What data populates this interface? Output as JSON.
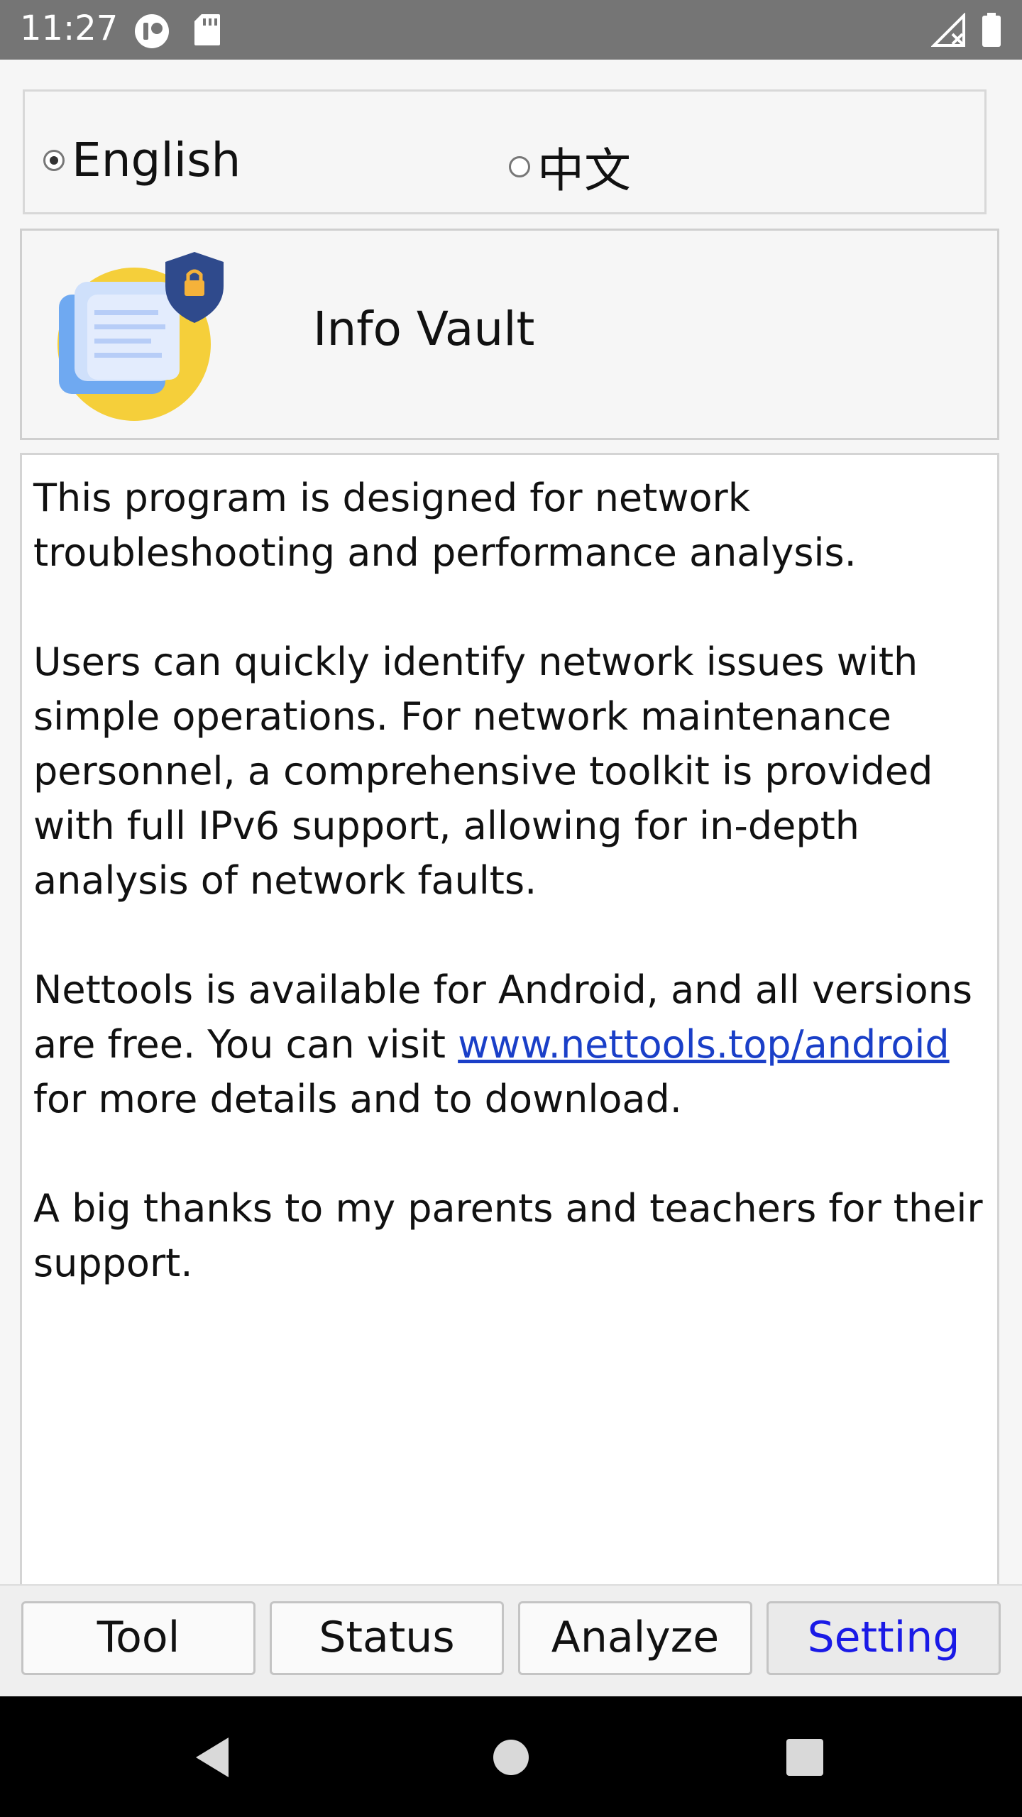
{
  "status_bar": {
    "time": "11:27"
  },
  "language": {
    "options": [
      {
        "label": "English",
        "checked": true
      },
      {
        "label": "中文",
        "checked": false
      }
    ]
  },
  "header": {
    "title": "Info Vault"
  },
  "content": {
    "paragraph1": "This program is designed for network troubleshooting and performance analysis.",
    "paragraph2": "Users can quickly identify network issues with simple operations. For network maintenance personnel, a comprehensive toolkit is provided with full IPv6 support, allowing for in-depth analysis of network faults.",
    "paragraph3_before": "Nettools is available for Android, and all versions are free. You can visit ",
    "paragraph3_link": "www.nettools.top/android",
    "paragraph3_after": " for more details and to download.",
    "paragraph4": "A big thanks to my parents and teachers for their support."
  },
  "tabs": [
    {
      "label": "Tool"
    },
    {
      "label": "Status"
    },
    {
      "label": "Analyze"
    },
    {
      "label": "Setting",
      "active": true
    }
  ],
  "colors": {
    "active_tab_text": "#1a1ae6",
    "link": "#1a3fc8",
    "status_bar": "#757575"
  },
  "icons": [
    "sync-icon",
    "sd-card-icon",
    "no-signal-icon",
    "battery-icon",
    "back-icon",
    "home-icon",
    "recents-icon",
    "document-shield-icon"
  ]
}
